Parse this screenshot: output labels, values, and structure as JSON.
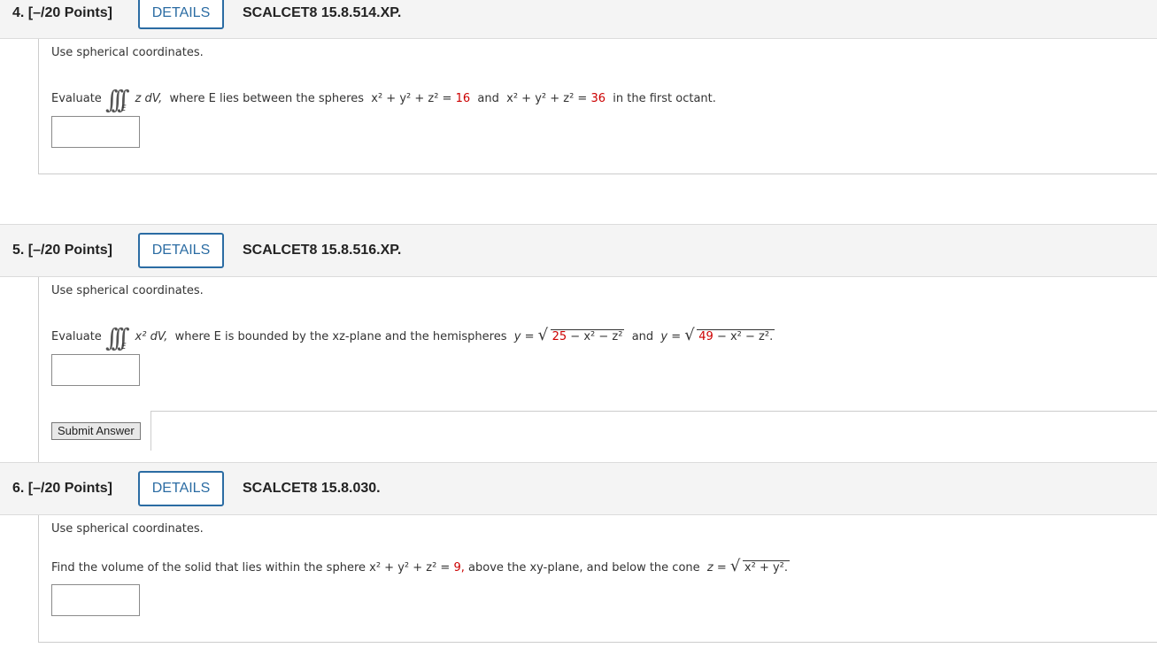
{
  "questions": [
    {
      "number_label": "4. [–/20 Points]",
      "details_label": "DETAILS",
      "code": "SCALCET8 15.8.514.XP.",
      "instruction": "Use spherical coordinates.",
      "evaluate_label": "Evaluate",
      "integral_region": "E",
      "integrand": "z dV,",
      "text_a": "where E lies between the spheres",
      "eq1_lhs": "x² + y² + z² =",
      "eq1_val": "16",
      "and": "and",
      "eq2_lhs": "x² + y² + z² =",
      "eq2_val": "36",
      "tail": "in the first octant."
    },
    {
      "number_label": "5. [–/20 Points]",
      "details_label": "DETAILS",
      "code": "SCALCET8 15.8.516.XP.",
      "instruction": "Use spherical coordinates.",
      "evaluate_label": "Evaluate",
      "integral_region": "E",
      "integrand": "x² dV,",
      "text_a": "where E is bounded by the xz-plane and the hemispheres",
      "h1_lhs": "y =",
      "h1_red": "25",
      "h1_rest": " − x² − z²",
      "and": "and",
      "h2_lhs": "y =",
      "h2_red": "49",
      "h2_rest": " − x² − z².",
      "submit_label": "Submit Answer"
    },
    {
      "number_label": "6. [–/20 Points]",
      "details_label": "DETAILS",
      "code": "SCALCET8 15.8.030.",
      "instruction": "Use spherical coordinates.",
      "text_a": "Find the volume of the solid that lies within the sphere",
      "eq_lhs": "x² + y² + z² =",
      "eq_val": "9,",
      "text_b": "above the xy-plane, and below the cone",
      "cone_lhs": "z =",
      "cone_rad": "x² + y².",
      "cone_rad_end": "."
    }
  ],
  "colors": {
    "accent": "#2b6ca3",
    "value_red": "#cc0000",
    "header_bg": "#f4f4f4"
  }
}
